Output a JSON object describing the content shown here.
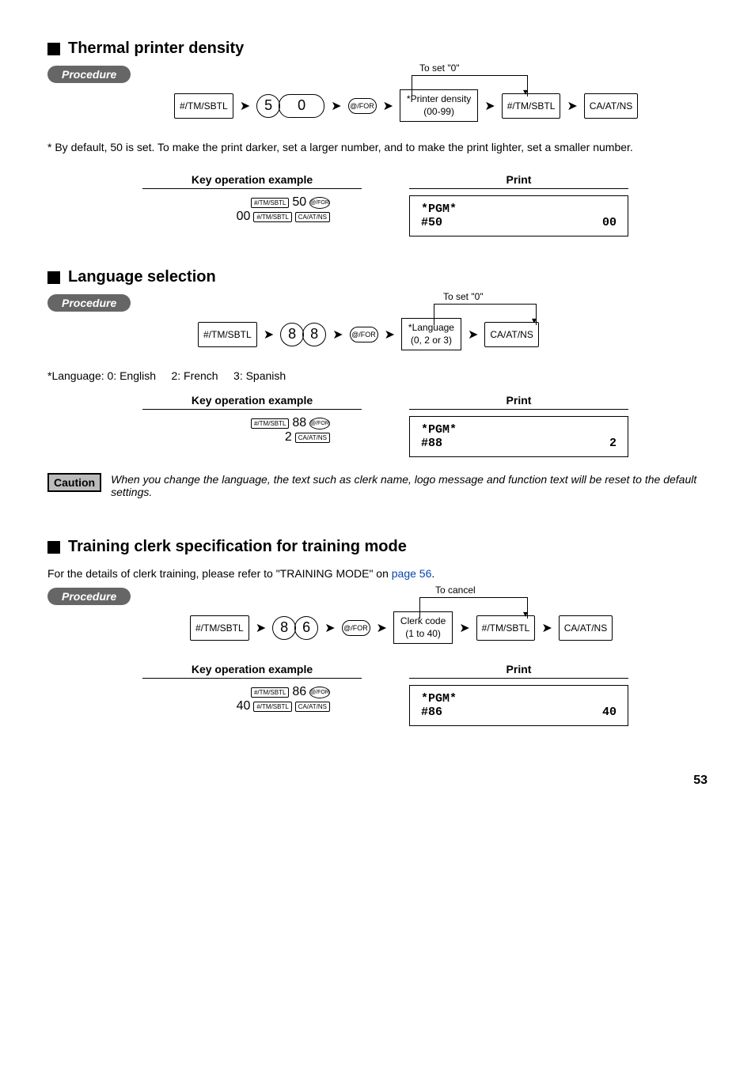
{
  "section1": {
    "title": "Thermal printer density",
    "procedure_label": "Procedure",
    "toset": "To set \"0\"",
    "k1": "#/TM/SBTL",
    "d1": "5",
    "d2": "0",
    "k2": "@/FOR",
    "param_top": "*Printer density",
    "param_bot": "(00-99)",
    "k3": "#/TM/SBTL",
    "k4": "CA/AT/NS",
    "footnote": "* By default, 50 is set.  To make the print darker, set a larger number, and to make the print lighter, set a smaller number.",
    "ex_header_left": "Key operation example",
    "ex_header_right": "Print",
    "ex_line1_key1": "#/TM/SBTL",
    "ex_line1_num": "50",
    "ex_line1_key2": "@/FOR",
    "ex_line2_num": "00",
    "ex_line2_key1": "#/TM/SBTL",
    "ex_line2_key2": "CA/AT/NS",
    "print_l1": "*PGM*",
    "print_l2": "#50",
    "print_r": "00"
  },
  "section2": {
    "title": "Language selection",
    "procedure_label": "Procedure",
    "toset": "To set \"0\"",
    "k1": "#/TM/SBTL",
    "d1": "8",
    "d2": "8",
    "k2": "@/FOR",
    "param_top": "*Language",
    "param_bot": "(0, 2 or 3)",
    "k3": "CA/AT/NS",
    "lang_note": "*Language: 0: English     2: French     3: Spanish",
    "ex_header_left": "Key operation example",
    "ex_header_right": "Print",
    "ex_line1_key1": "#/TM/SBTL",
    "ex_line1_num": "88",
    "ex_line1_key2": "@/FOR",
    "ex_line2_num": "2",
    "ex_line2_key1": "CA/AT/NS",
    "print_l1": "*PGM*",
    "print_l2": "#88",
    "print_r": "2",
    "caution_label": "Caution",
    "caution_text": "When you change the language, the text such as clerk name, logo message and function text will be reset to the default settings."
  },
  "section3": {
    "title": "Training clerk specification for training mode",
    "intro_pre": "For the details of clerk training, please refer to \"TRAINING MODE\" on ",
    "intro_link": "page 56",
    "intro_post": ".",
    "procedure_label": "Procedure",
    "toset": "To cancel",
    "k1": "#/TM/SBTL",
    "d1": "8",
    "d2": "6",
    "k2": "@/FOR",
    "param_top": "Clerk code",
    "param_bot": "(1 to 40)",
    "k3": "#/TM/SBTL",
    "k4": "CA/AT/NS",
    "ex_header_left": "Key operation example",
    "ex_header_right": "Print",
    "ex_line1_key1": "#/TM/SBTL",
    "ex_line1_num": "86",
    "ex_line1_key2": "@/FOR",
    "ex_line2_num": "40",
    "ex_line2_key1": "#/TM/SBTL",
    "ex_line2_key2": "CA/AT/NS",
    "print_l1": "*PGM*",
    "print_l2": "#86",
    "print_r": "40"
  },
  "page": "53"
}
